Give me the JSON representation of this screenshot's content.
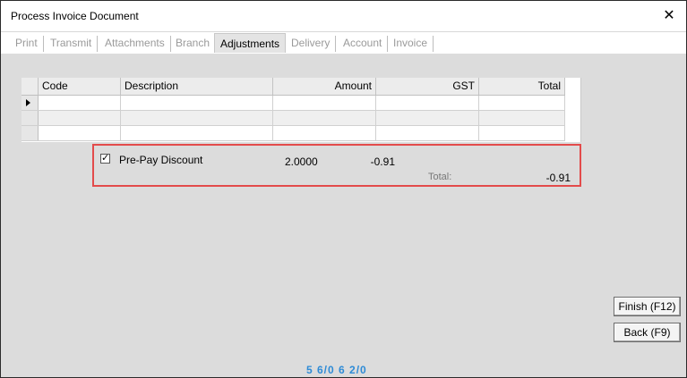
{
  "window": {
    "title": "Process Invoice Document"
  },
  "tabs": [
    {
      "label": "Print"
    },
    {
      "label": "Transmit"
    },
    {
      "label": "Attachments"
    },
    {
      "label": "Branch"
    },
    {
      "label": "Adjustments"
    },
    {
      "label": "Delivery"
    },
    {
      "label": "Account"
    },
    {
      "label": "Invoice"
    }
  ],
  "grid": {
    "columns": [
      "Code",
      "Description",
      "Amount",
      "GST",
      "Total"
    ],
    "rows": [
      [
        "",
        "",
        "",
        "",
        ""
      ],
      [
        "",
        "",
        "",
        "",
        ""
      ],
      [
        "",
        "",
        "",
        "",
        ""
      ]
    ]
  },
  "discount": {
    "checked": true,
    "check_glyph": "✓",
    "label": "Pre-Pay Discount",
    "rate": "2.0000",
    "amount": "-0.91",
    "total_label": "Total:",
    "total_value": "-0.91"
  },
  "buttons": {
    "finish": "Finish (F12)",
    "back": "Back (F9)"
  },
  "status_text": "5 6/0   6 2/0",
  "colors": {
    "highlight_border": "#e34b4b",
    "status_text": "#2e8bd6"
  }
}
